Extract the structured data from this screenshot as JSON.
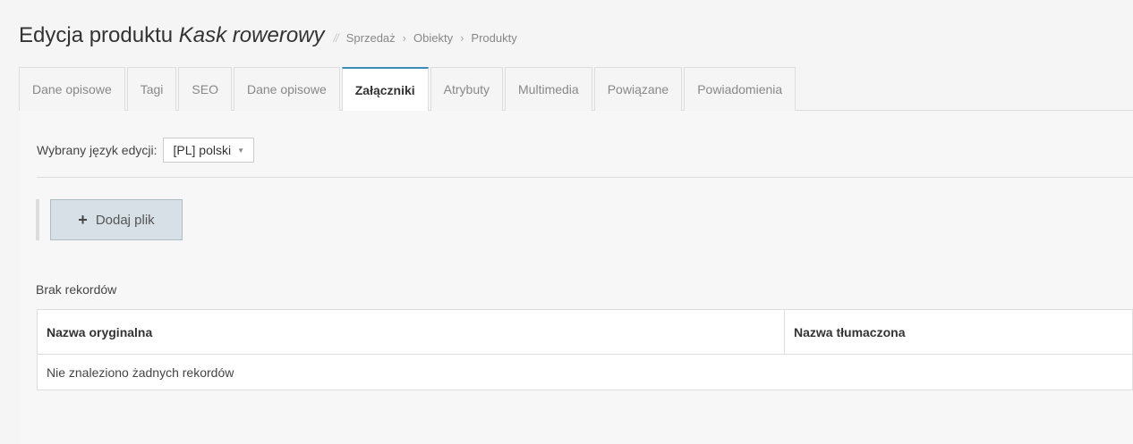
{
  "header": {
    "title": "Edycja produktu",
    "product": "Kask rowerowy",
    "separator": "//",
    "breadcrumb": [
      "Sprzedaż",
      "Obiekty",
      "Produkty"
    ],
    "chevron": "›"
  },
  "tabs": [
    {
      "label": "Dane opisowe",
      "active": false
    },
    {
      "label": "Tagi",
      "active": false
    },
    {
      "label": "SEO",
      "active": false
    },
    {
      "label": "Dane opisowe",
      "active": false
    },
    {
      "label": "Załączniki",
      "active": true
    },
    {
      "label": "Atrybuty",
      "active": false
    },
    {
      "label": "Multimedia",
      "active": false
    },
    {
      "label": "Powiązane",
      "active": false
    },
    {
      "label": "Powiadomienia",
      "active": false
    }
  ],
  "language": {
    "label": "Wybrany język edycji:",
    "selected": "[PL] polski"
  },
  "toolbar": {
    "add_icon": "plus-icon",
    "add_label": "Dodaj plik"
  },
  "records": {
    "summary": "Brak rekordów",
    "columns": [
      "Nazwa oryginalna",
      "Nazwa tłumaczona"
    ],
    "empty_message": "Nie znaleziono żadnych rekordów"
  },
  "colors": {
    "active_tab_accent": "#3c8dbc",
    "button_bg": "#d7e0e6"
  }
}
